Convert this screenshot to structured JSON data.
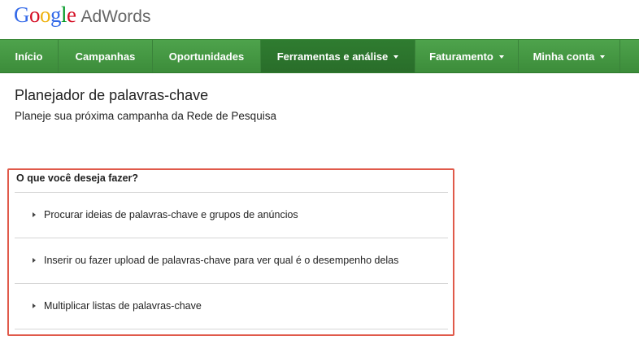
{
  "logo": {
    "brand_letters": [
      "G",
      "o",
      "o",
      "g",
      "l",
      "e"
    ],
    "product": "AdWords"
  },
  "nav": {
    "items": [
      {
        "label": "Início",
        "has_dropdown": false,
        "active": false
      },
      {
        "label": "Campanhas",
        "has_dropdown": false,
        "active": false
      },
      {
        "label": "Oportunidades",
        "has_dropdown": false,
        "active": false
      },
      {
        "label": "Ferramentas e análise",
        "has_dropdown": true,
        "active": true
      },
      {
        "label": "Faturamento",
        "has_dropdown": true,
        "active": false
      },
      {
        "label": "Minha conta",
        "has_dropdown": true,
        "active": false
      }
    ],
    "colors": {
      "bar": "#3f903d",
      "active": "#2c752d"
    }
  },
  "page": {
    "title": "Planejador de palavras-chave",
    "subtitle": "Planeje sua próxima campanha da Rede de Pesquisa"
  },
  "panel": {
    "heading": "O que você deseja fazer?",
    "border_color": "#e05a4a",
    "options": [
      {
        "label": "Procurar ideias de palavras-chave e grupos de anúncios",
        "icon": "triangle-right-icon"
      },
      {
        "label": "Inserir ou fazer upload de palavras-chave para ver qual é o desempenho delas",
        "icon": "triangle-right-icon"
      },
      {
        "label": "Multiplicar listas de palavras-chave",
        "icon": "triangle-right-icon"
      }
    ]
  }
}
